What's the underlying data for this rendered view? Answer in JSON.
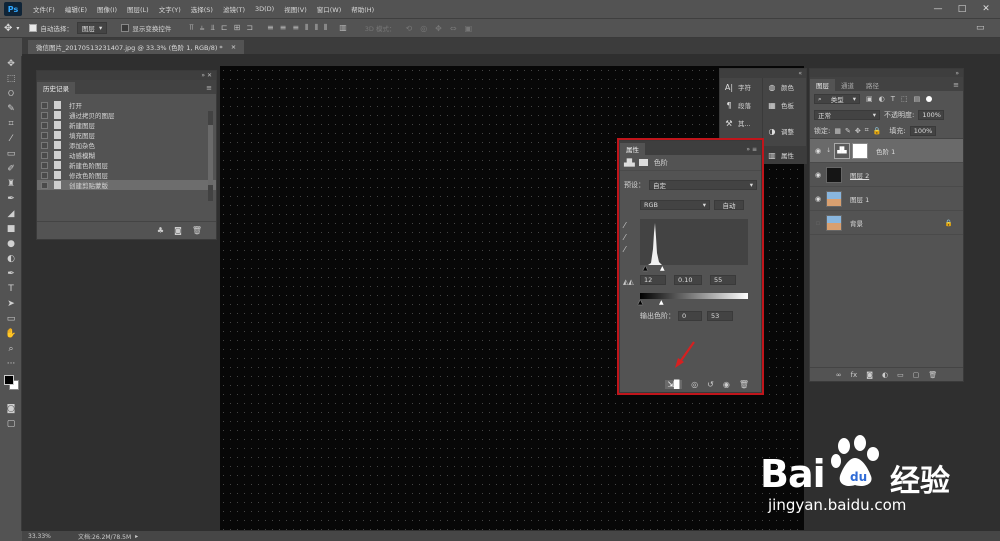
{
  "menubar": {
    "logo": "Ps",
    "items": [
      "文件(F)",
      "编辑(E)",
      "图像(I)",
      "图层(L)",
      "文字(Y)",
      "选择(S)",
      "滤镜(T)",
      "3D(D)",
      "视图(V)",
      "窗口(W)",
      "帮助(H)"
    ],
    "min": "—",
    "max": "□",
    "close": "✕"
  },
  "options": {
    "auto_select_label": "自动选择：",
    "auto_select_value": "图层",
    "show_transform": "显示变换控件",
    "mode3d": "3D 模式："
  },
  "document": {
    "tab_title": "微信图片_20170513231407.jpg @ 33.3% (色阶 1, RGB/8) *",
    "tab_close": "×"
  },
  "status": {
    "zoom": "33.33%",
    "doc": "文档:26.2M/78.5M"
  },
  "history": {
    "title": "历史记录",
    "items": [
      "打开",
      "通过拷贝的图层",
      "新建图层",
      "填充图层",
      "添加杂色",
      "动感模糊",
      "新建色阶图层",
      "修改色阶图层",
      "创建剪贴蒙版"
    ]
  },
  "mini_panels": {
    "col1": [
      "字符",
      "段落",
      "其..."
    ],
    "col2": [
      "颜色",
      "色板",
      "调整",
      "属性"
    ]
  },
  "properties": {
    "title": "属性",
    "type_label": "色阶",
    "preset_label": "预设：",
    "preset_value": "自定",
    "channel": "RGB",
    "auto": "自动",
    "input_black": "12",
    "input_gamma": "0.10",
    "input_white": "55",
    "output_label": "输出色阶：",
    "output_black": "0",
    "output_white": "53"
  },
  "layers": {
    "tabs": [
      "图层",
      "通道",
      "路径"
    ],
    "filter": "类型",
    "blend": "正常",
    "opacity_label": "不透明度:",
    "opacity_value": "100%",
    "lock_label": "锁定:",
    "fill_label": "填充:",
    "fill_value": "100%",
    "rows": [
      {
        "name": "色阶 1"
      },
      {
        "name": "图层 2"
      },
      {
        "name": "图层 1"
      },
      {
        "name": "背景"
      }
    ]
  },
  "watermark": {
    "bai": "Bai",
    "du": "du",
    "cn": "经验",
    "url": "jingyan.baidu.com"
  },
  "colors": {
    "accent_red": "#c0151b",
    "panel": "#535353",
    "canvas": "#070707"
  }
}
